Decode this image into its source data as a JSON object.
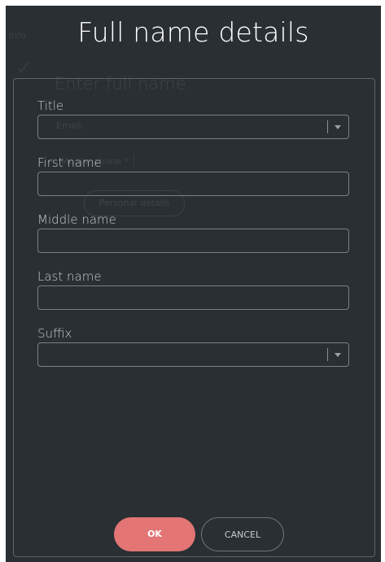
{
  "background": {
    "info_label": "Info",
    "heading": "Enter full name",
    "email_label": "Email:",
    "mobile_label": "Mobile phone *",
    "personal_details_button": "Personal details"
  },
  "dialog": {
    "title": "Full name details",
    "fields": [
      {
        "label": "Title",
        "type": "select",
        "value": ""
      },
      {
        "label": "First name",
        "type": "text",
        "value": ""
      },
      {
        "label": "Middle name",
        "type": "text",
        "value": ""
      },
      {
        "label": "Last name",
        "type": "text",
        "value": ""
      },
      {
        "label": "Suffix",
        "type": "select",
        "value": ""
      }
    ],
    "ok_label": "OK",
    "cancel_label": "CANCEL"
  },
  "colors": {
    "overlay_bg": "#2a2f33",
    "ok_button": "#e37575",
    "border": "#7a8085",
    "label_text": "#c6cbcf"
  },
  "icons": {
    "select_arrow": "chevron-down-icon",
    "background_check": "check-icon"
  }
}
